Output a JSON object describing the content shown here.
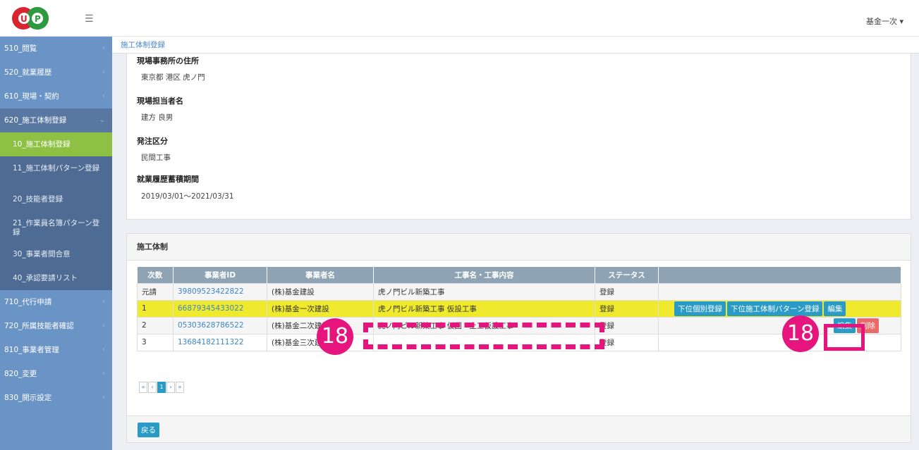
{
  "header": {
    "user_menu": "基金一次 ▾"
  },
  "sidebar": {
    "items": [
      {
        "label": "510_閲覧"
      },
      {
        "label": "520_就業履歴"
      },
      {
        "label": "610_現場・契約"
      },
      {
        "label": "620_施工体制登録"
      }
    ],
    "sub_items": [
      {
        "label": "10_施工体制登録"
      },
      {
        "label": "11_施工体制パターン登録"
      },
      {
        "label": "20_技能者登録"
      },
      {
        "label": "21_作業員名簿パターン登録"
      },
      {
        "label": "30_事業者間合意"
      },
      {
        "label": "40_承認要請リスト"
      }
    ],
    "items_after": [
      {
        "label": "710_代行申請"
      },
      {
        "label": "720_所属技能者確認"
      },
      {
        "label": "810_事業者管理"
      },
      {
        "label": "820_変更"
      },
      {
        "label": "830_開示設定"
      }
    ]
  },
  "breadcrumb": "施工体制登録",
  "info": {
    "address_label": "現場事務所の住所",
    "address_value": "東京都 港区 虎ノ門",
    "manager_label": "現場担当者名",
    "manager_value": "建方 良男",
    "order_label": "発注区分",
    "order_value": "民間工事",
    "period_label": "就業履歴蓄積期間",
    "period_value": "2019/03/01〜2021/03/31"
  },
  "structure": {
    "title": "施工体制",
    "columns": [
      "次数",
      "事業者ID",
      "事業者名",
      "工事名・工事内容",
      "ステータス",
      ""
    ],
    "rows": [
      {
        "level": "元請",
        "id": "39809523422822",
        "name": "(株)基金建設",
        "work": "虎ノ門ビル新築工事",
        "status": "登録"
      },
      {
        "level": "1",
        "id": "66879345433022",
        "name": "(株)基金一次建設",
        "work": "虎ノ門ビル新築工事 仮設工事",
        "status": "登録"
      },
      {
        "level": "2",
        "id": "05303628786522",
        "name": "(株)基金二次建設",
        "work": "虎ノ門ビル新築工事 仮囲・土工仮設工事",
        "status": "登録"
      },
      {
        "level": "3",
        "id": "13684182111322",
        "name": "(株)基金三次建設",
        "work": "",
        "status": "登録"
      }
    ],
    "btn_sub_register": "下位個別登録",
    "btn_sub_pattern": "下位施工体制パターン登録",
    "btn_edit": "編集",
    "btn_delete": "削除",
    "pager": [
      "«",
      "‹",
      "1",
      "›",
      "»"
    ],
    "back": "戻る"
  },
  "annotations": {
    "badge_left": "18",
    "badge_right": "18",
    "accent": "#e6157d"
  }
}
